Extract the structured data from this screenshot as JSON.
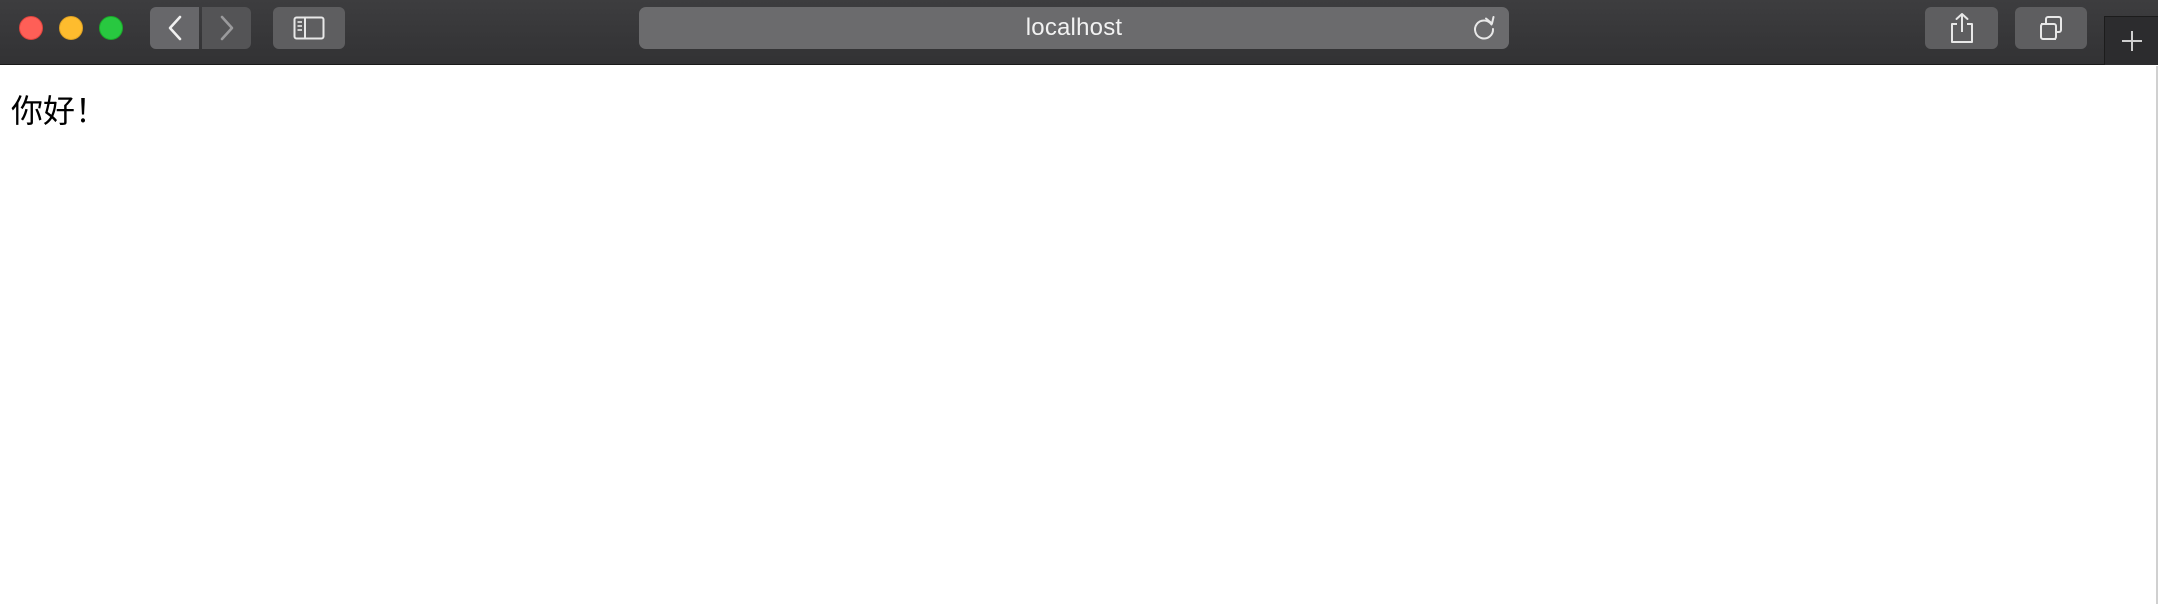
{
  "browser": {
    "address_bar": {
      "url_text": "localhost"
    },
    "toolbar": {
      "icons": {
        "close": "close-window-icon",
        "minimize": "minimize-window-icon",
        "maximize": "maximize-window-icon",
        "back": "chevron-left-icon",
        "forward": "chevron-right-icon",
        "sidebar": "sidebar-icon",
        "reload": "reload-icon",
        "share": "share-icon",
        "tabs": "tab-overview-icon",
        "new_tab": "plus-icon"
      }
    },
    "colors": {
      "close": "#fe5f57",
      "minimize": "#febc2e",
      "maximize": "#28c840",
      "toolbar": "#3a3a3c",
      "address_bar": "#6b6b6d"
    }
  },
  "page": {
    "body_text": "你好！"
  }
}
